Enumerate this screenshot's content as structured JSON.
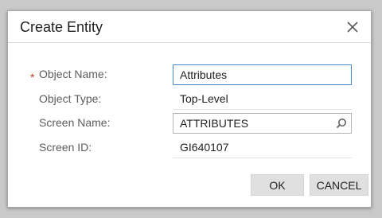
{
  "dialog": {
    "title": "Create Entity",
    "close_icon": "close-icon"
  },
  "form": {
    "object_name": {
      "label": "Object Name:",
      "required_marker": "*",
      "value": "Attributes"
    },
    "object_type": {
      "label": "Object Type:",
      "value": "Top-Level"
    },
    "screen_name": {
      "label": "Screen Name:",
      "value": "ATTRIBUTES",
      "icon": "search-icon"
    },
    "screen_id": {
      "label": "Screen ID:",
      "value": "GI640107"
    }
  },
  "buttons": {
    "ok_label": "OK",
    "cancel_label": "CANCEL"
  },
  "colors": {
    "required": "#c0392b",
    "focus_border": "#4d8bd0",
    "button_bg": "#e0e0e0"
  }
}
